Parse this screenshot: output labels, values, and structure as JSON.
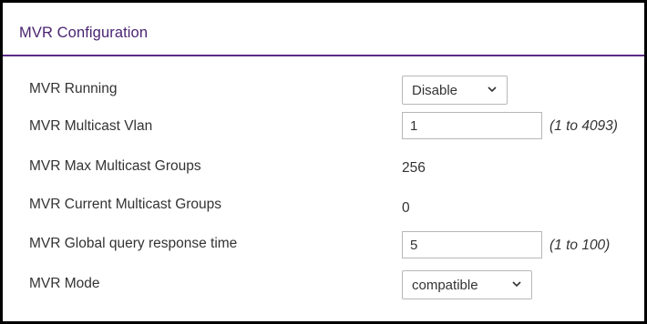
{
  "panel": {
    "title": "MVR Configuration"
  },
  "rows": {
    "running": {
      "label": "MVR Running",
      "value": "Disable"
    },
    "multicast_vlan": {
      "label": "MVR Multicast Vlan",
      "value": "1",
      "hint": "(1 to 4093)"
    },
    "max_groups": {
      "label": "MVR Max Multicast Groups",
      "value": "256"
    },
    "current_groups": {
      "label": "MVR Current Multicast Groups",
      "value": "0"
    },
    "query_time": {
      "label": "MVR Global query response time",
      "value": "5",
      "hint": "(1 to 100)"
    },
    "mode": {
      "label": "MVR Mode",
      "value": "compatible"
    }
  },
  "icons": {
    "dropdown": "chevron-down-icon"
  },
  "colors": {
    "accent": "#4b2472",
    "border": "#000000"
  }
}
